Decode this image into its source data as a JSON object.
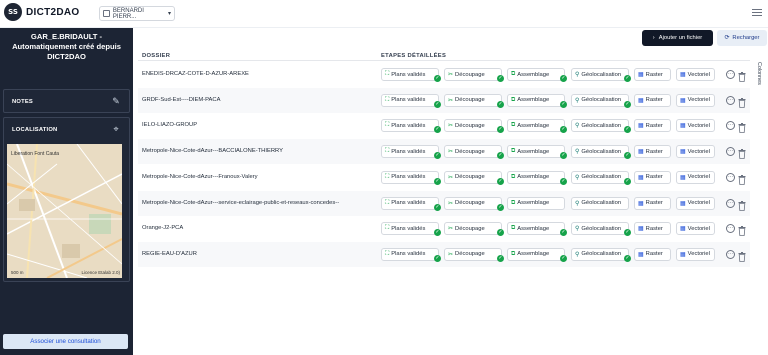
{
  "app": {
    "logo_badge": "SS",
    "name": "DICT2DAO"
  },
  "user_select": {
    "value": "BERNARDI PIERR..."
  },
  "sidebar": {
    "title_line1": "GAR_E.BRIDAULT -",
    "title_line2": "Automatiquement créé depuis",
    "title_line3": "DICT2DAO",
    "notes_label": "NOTES",
    "localisation_label": "LOCALISATION",
    "map_text": "Liberation Font Cauta",
    "map_scale": "500 m",
    "map_license": "Licence Etalab 2.0)",
    "assoc_button": "Associer une consultation"
  },
  "toolbar": {
    "add_file": "Ajouter un fichier",
    "reload": "Recharger",
    "columns": "Colonnes"
  },
  "table": {
    "headers": {
      "dossier": "DOSSIER",
      "etapes": "ETAPES DÉTAILLÉES"
    },
    "step_labels": {
      "plans": "Plans validés",
      "decoupage": "Découpage",
      "assemblage": "Assemblage",
      "geoloc": "Géolocalisation",
      "raster": "Raster",
      "vectoriel": "Vectoriel"
    },
    "rows": [
      {
        "dossier": "ENEDIS-DRCAZ-COTE-D-AZUR-AREXE",
        "assemblage_done": true,
        "geoloc_done": true
      },
      {
        "dossier": "GRDF-Sud-Est----DIEM-PACA",
        "assemblage_done": true,
        "geoloc_done": true
      },
      {
        "dossier": "IELO-LIAZO-GROUP",
        "assemblage_done": true,
        "geoloc_done": true
      },
      {
        "dossier": "Metropole-Nice-Cote-dAzur---BACCIALONE-THIERRY",
        "assemblage_done": true,
        "geoloc_done": true
      },
      {
        "dossier": "Metropole-Nice-Cote-dAzur---Franoux-Valery",
        "assemblage_done": true,
        "geoloc_done": true
      },
      {
        "dossier": "Metropole-Nice-Cote-dAzur---service-eclairage-public-et-reseaux-concedes--",
        "assemblage_done": false,
        "geoloc_done": false
      },
      {
        "dossier": "Orange-J2-PCA",
        "assemblage_done": true,
        "geoloc_done": true
      },
      {
        "dossier": "REGIE-EAU-D'AZUR",
        "assemblage_done": true,
        "geoloc_done": true
      }
    ]
  }
}
